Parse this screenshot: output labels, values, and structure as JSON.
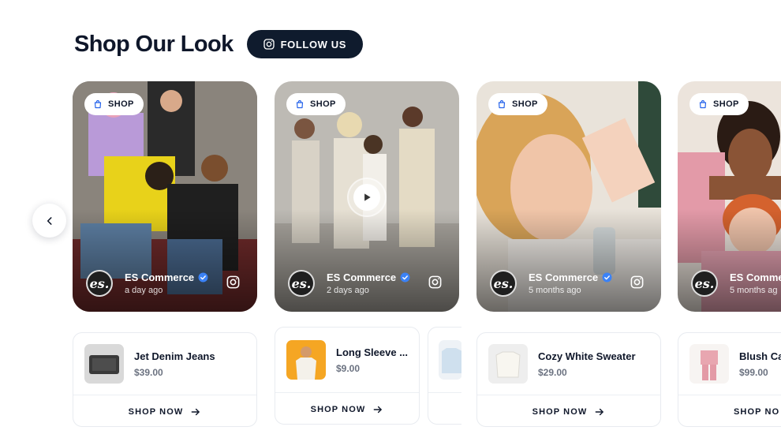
{
  "header": {
    "title": "Shop Our Look",
    "follow_label": "FOLLOW US"
  },
  "shop_label": "SHOP",
  "cards": [
    {
      "author": "ES Commerce",
      "time": "a day ago",
      "avatar": "es."
    },
    {
      "author": "ES Commerce",
      "time": "2 days ago",
      "avatar": "es."
    },
    {
      "author": "ES Commerce",
      "time": "5 months ago",
      "avatar": "es."
    },
    {
      "author": "ES Comme",
      "time": "5 months ag",
      "avatar": "es."
    }
  ],
  "products": [
    {
      "name": "Jet Denim Jeans",
      "price": "$39.00"
    },
    {
      "name": "Long Sleeve ...",
      "price": "$9.00"
    },
    {
      "name": "Cozy White Sweater",
      "price": "$29.00"
    },
    {
      "name": "Blush Ca",
      "price": "$99.00"
    }
  ],
  "shop_now_label": "SHOP NOW",
  "partial_shop_now_label": "SHOP NO",
  "icons": {
    "follow": "instagram-icon",
    "shop": "shopping-bag-icon",
    "verified": "verified-badge-icon",
    "play": "play-icon",
    "prev": "chevron-left-icon",
    "arrow": "arrow-right-icon"
  },
  "colors": {
    "brand_dark": "#0f1b2d",
    "verified": "#3b82f6",
    "muted": "#6b7280"
  }
}
